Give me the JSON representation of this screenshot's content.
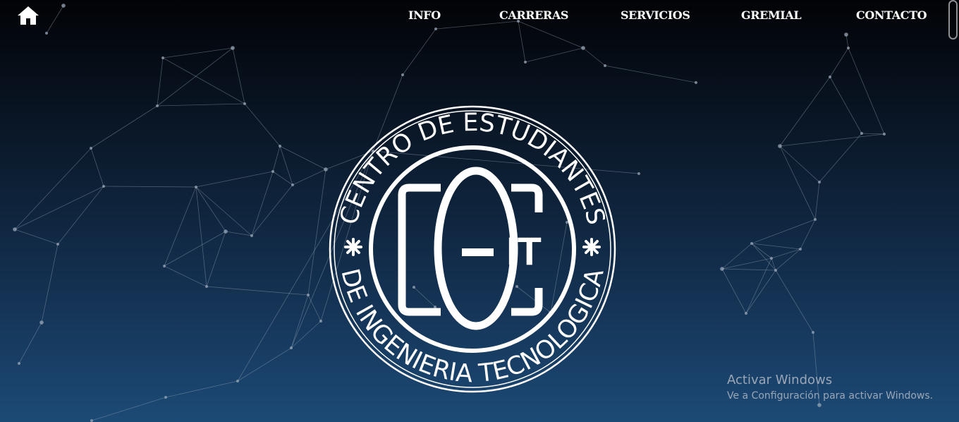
{
  "nav": {
    "items": [
      {
        "label": "INFO"
      },
      {
        "label": "CARRERAS"
      },
      {
        "label": "SERVICIOS"
      },
      {
        "label": "GREMIAL"
      },
      {
        "label": "CONTACTO"
      }
    ]
  },
  "icons": {
    "home": "home-icon"
  },
  "emblem": {
    "ring_top_text": "CENTRO DE ESTUDIANTES",
    "ring_bottom_text": "DE INGENIERIA TECNOLOGICA",
    "monogram_it": "IT"
  },
  "watermark": {
    "title": "Activar Windows",
    "subtitle": "Ve a Configuración para activar Windows."
  },
  "colors": {
    "background_top": "#020306",
    "background_bottom": "#1c4a76",
    "foreground": "#ffffff",
    "network_lines": "#9aa7b8"
  }
}
